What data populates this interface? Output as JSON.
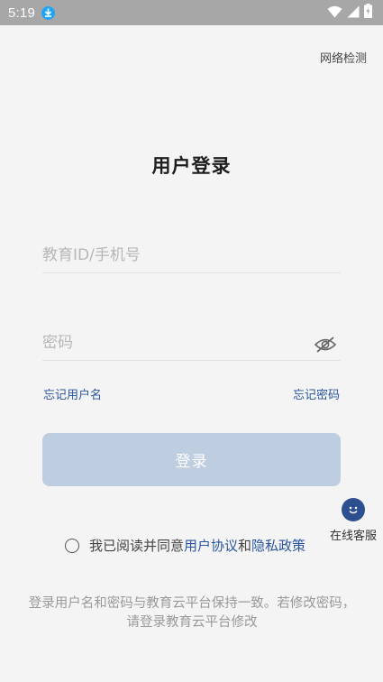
{
  "status_bar": {
    "time": "5:19",
    "download_icon": "download-icon",
    "wifi_icon": "wifi-icon",
    "signal_icon": "cell-signal-icon",
    "battery_icon": "battery-charging-icon"
  },
  "header": {
    "network_check": "网络检测"
  },
  "title": "用户登录",
  "form": {
    "account_placeholder": "教育ID/手机号",
    "account_value": "",
    "password_placeholder": "密码",
    "password_value": "",
    "password_toggle_icon": "eye-slash-icon",
    "forgot_username": "忘记用户名",
    "forgot_password": "忘记密码",
    "login_button": "登录"
  },
  "online_service": {
    "icon": "smiley-chat-icon",
    "label": "在线客服"
  },
  "agreement": {
    "prefix": "我已阅读并同意",
    "user_agreement": "用户协议",
    "and": "和",
    "privacy_policy": "隐私政策",
    "checked": false
  },
  "notice": "登录用户名和密码与教育云平台保持一致。若修改密码，请登录教育云平台修改",
  "colors": {
    "status_bar": "#a7a7a7",
    "background": "#f4f4f4",
    "link": "#2b55a0",
    "login_button_disabled": "#bfcde0",
    "service_icon": "#2c4f8f"
  }
}
